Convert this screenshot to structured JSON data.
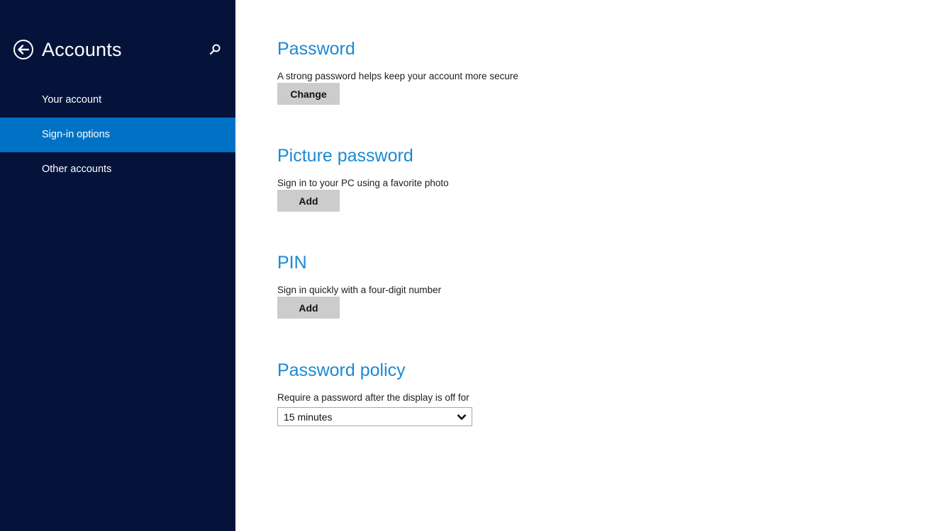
{
  "sidebar": {
    "title": "Accounts",
    "back_icon": "back-arrow-circle-icon",
    "search_icon": "search-icon",
    "items": [
      {
        "label": "Your account",
        "active": false
      },
      {
        "label": "Sign-in options",
        "active": true
      },
      {
        "label": "Other accounts",
        "active": false
      }
    ]
  },
  "colors": {
    "sidebar_bg": "#05133b",
    "accent": "#0072c6",
    "heading": "#1a8ad3",
    "button_bg": "#cccccc"
  },
  "sections": {
    "password": {
      "title": "Password",
      "description": "A strong password helps keep your account more secure",
      "button": "Change"
    },
    "picture_password": {
      "title": "Picture password",
      "description": "Sign in to your PC using a favorite photo",
      "button": "Add"
    },
    "pin": {
      "title": "PIN",
      "description": "Sign in quickly with a four-digit number",
      "button": "Add"
    },
    "password_policy": {
      "title": "Password policy",
      "description": "Require a password after the display is off for",
      "selected": "15 minutes"
    }
  }
}
